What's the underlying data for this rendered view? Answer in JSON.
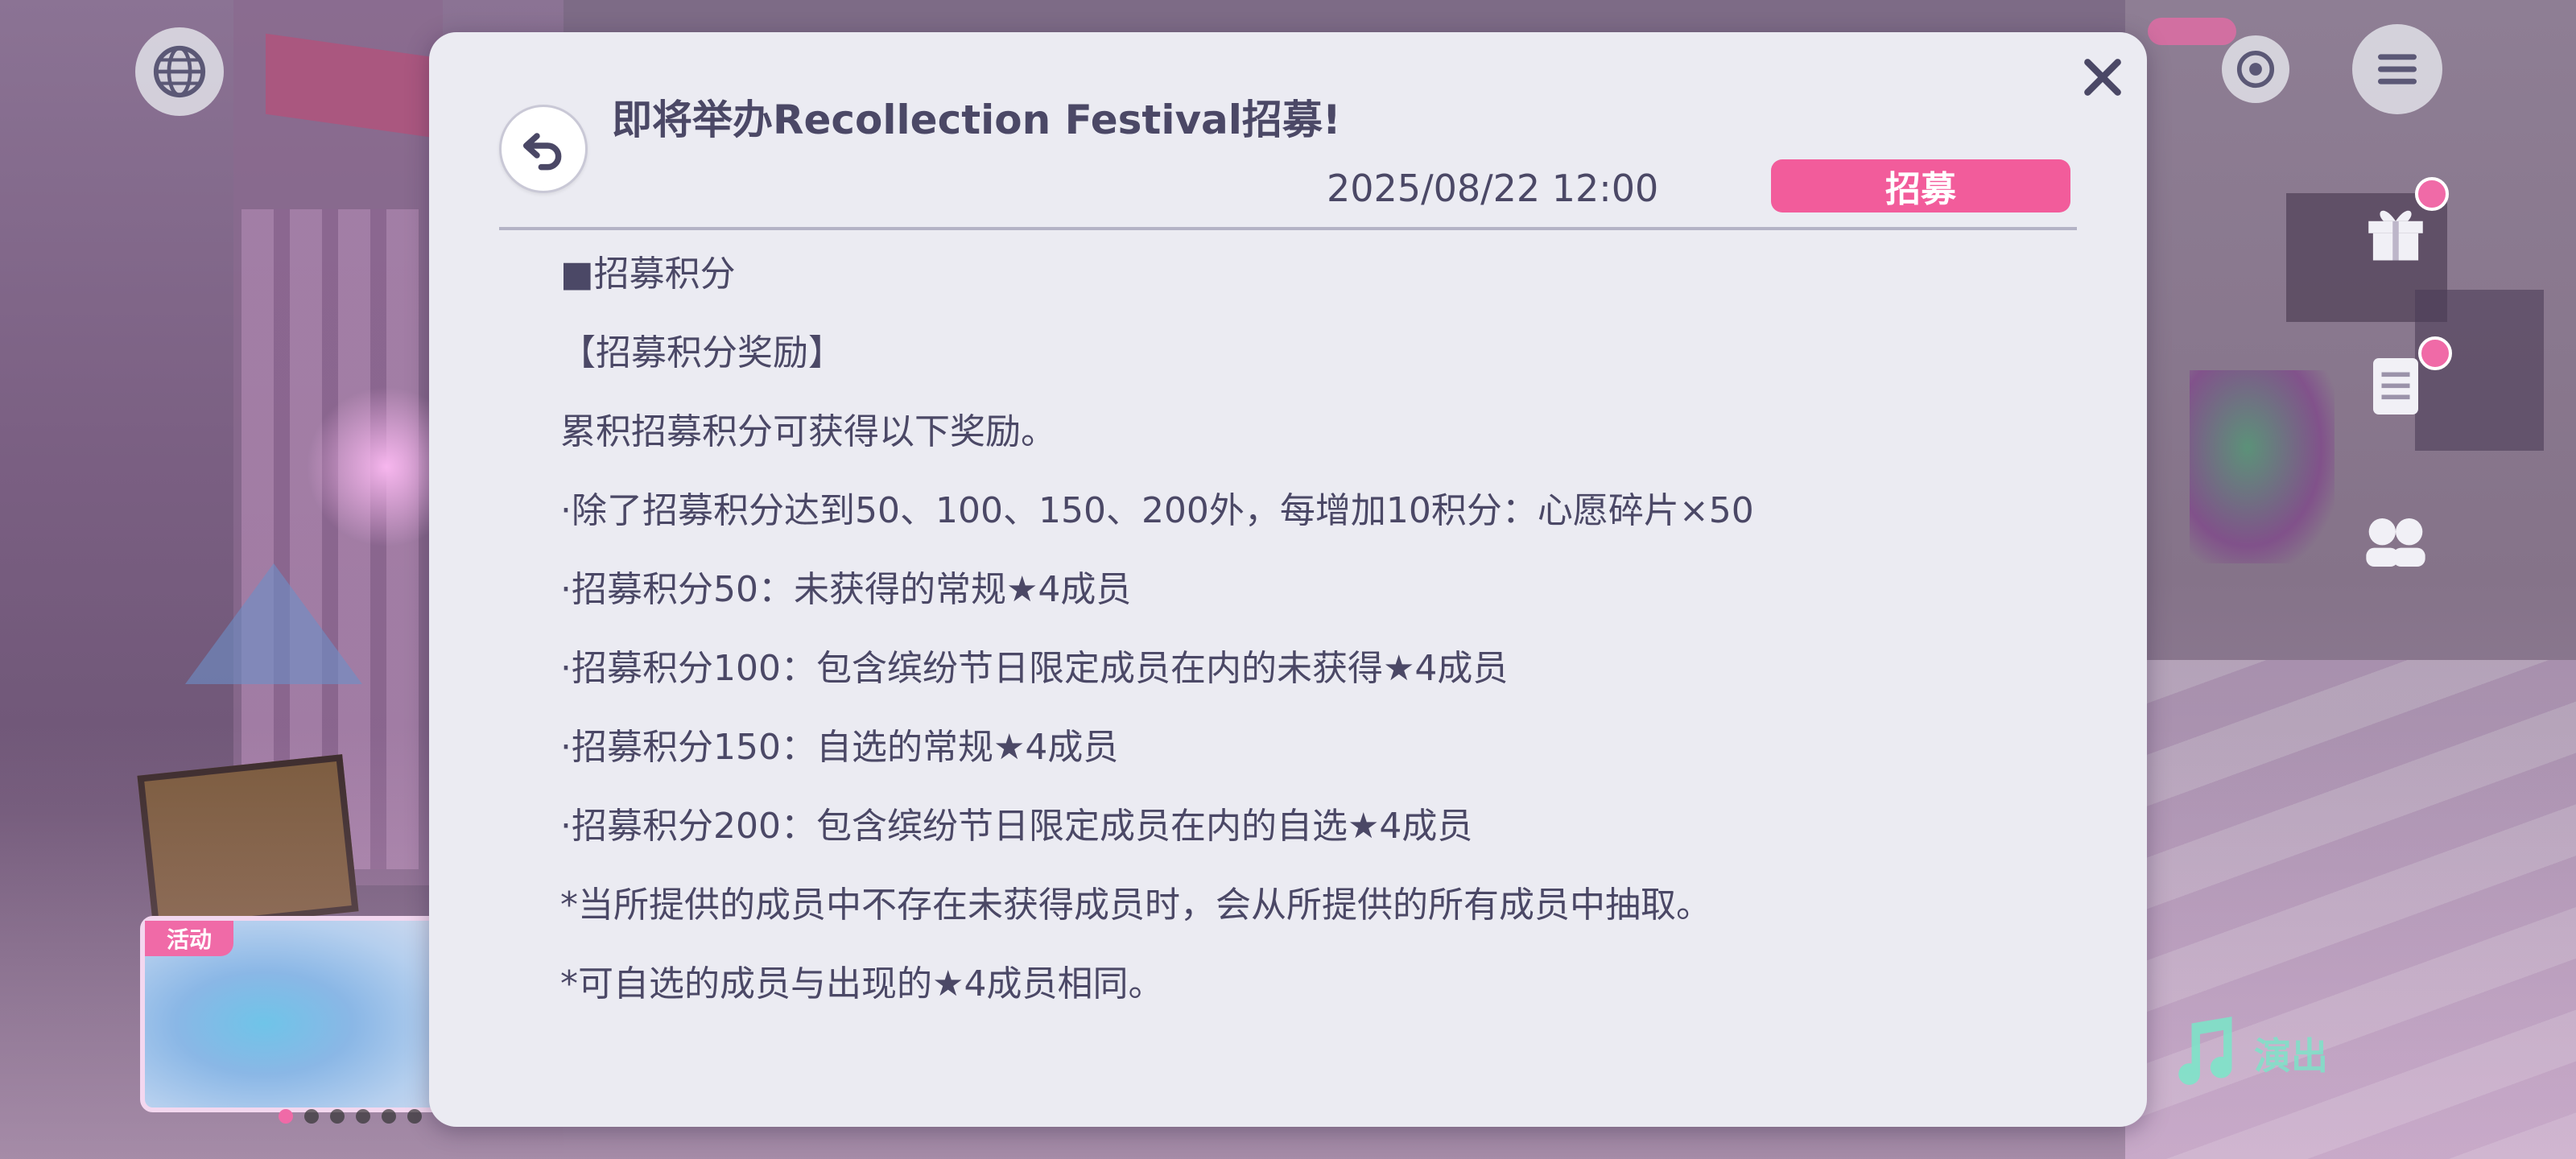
{
  "modal": {
    "title": "即将举办Recollection Festival招募!",
    "date": "2025/08/22 12:00",
    "badge": "招募",
    "body": [
      "■招募积分",
      "【招募积分奖励】",
      "累积招募积分可获得以下奖励。",
      "·除了招募积分达到50、100、150、200外，每增加10积分：心愿碎片×50",
      "·招募积分50：未获得的常规★4成员",
      "·招募积分100：包含缤纷节日限定成员在内的未获得★4成员",
      "·招募积分150：自选的常规★4成员",
      "·招募积分200：包含缤纷节日限定成员在内的自选★4成员",
      "*当所提供的成员中不存在未获得成员时，会从所提供的所有成员中抽取。",
      "*可自选的成员与出现的★4成员相同。"
    ]
  },
  "hud": {
    "live_label": "演出",
    "event_tag": "活动",
    "banner_dot_count": 6,
    "banner_active_index": 0
  },
  "icons": {
    "close": "close-icon",
    "back": "back-arrow-icon",
    "globe": "globe-icon",
    "target": "target-icon",
    "menu": "hamburger-menu-icon",
    "gift": "gift-icon",
    "list": "list-icon",
    "people": "people-icon",
    "live": "music-note-icon"
  },
  "colors": {
    "modal_bg": "#ebebf2",
    "text": "#4b4866",
    "accent_pink": "#f25c9b",
    "divider": "#b4b3c6"
  }
}
